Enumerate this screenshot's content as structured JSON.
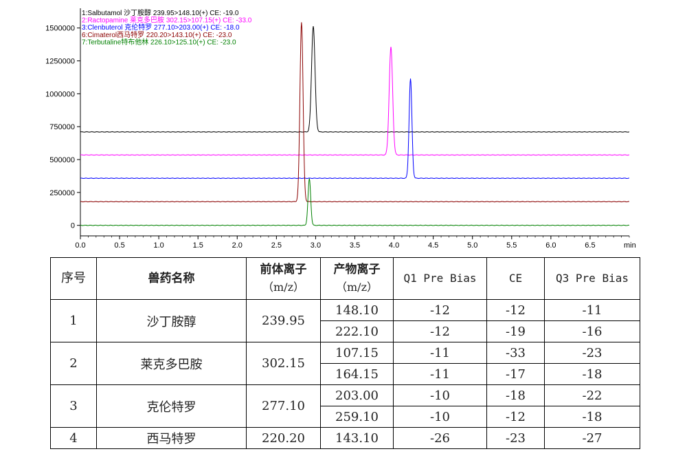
{
  "chart_data": {
    "type": "line",
    "xlabel": "min",
    "xlim": [
      0.0,
      7.0
    ],
    "ylim": [
      -80000,
      1650000
    ],
    "xticks": [
      "0.0",
      "0.5",
      "1.0",
      "1.5",
      "2.0",
      "2.5",
      "3.0",
      "3.5",
      "4.0",
      "4.5",
      "5.0",
      "5.5",
      "6.0",
      "6.5"
    ],
    "yticks": [
      {
        "value": 0,
        "label": "0"
      },
      {
        "value": 250000,
        "label": "250000"
      },
      {
        "value": 500000,
        "label": "500000"
      },
      {
        "value": 750000,
        "label": "750000"
      },
      {
        "value": 1000000,
        "label": "1000000"
      },
      {
        "value": 1250000,
        "label": "1250000"
      },
      {
        "value": 1500000,
        "label": "1500000"
      }
    ],
    "series": [
      {
        "name": "1:Salbutamol 沙丁胺醇 239.95>148.10(+) CE: -19.0",
        "color": "#000000",
        "baseline": 710000,
        "peak_time": 2.97,
        "peak_value": 1515000,
        "width": 0.022
      },
      {
        "name": "2:Ractopamine 莱克多巴胺 302.15>107.15(+) CE: -33.0",
        "color": "#ff00ff",
        "baseline": 535000,
        "peak_time": 3.96,
        "peak_value": 1355000,
        "width": 0.022
      },
      {
        "name": "3:Clenbuterol 克伦特罗 277.10>203.00(+) CE: -18.0",
        "color": "#0000ff",
        "baseline": 358000,
        "peak_time": 4.21,
        "peak_value": 1115000,
        "width": 0.018
      },
      {
        "name": "6:Cimaterol西马特罗 220.20>143.10(+) CE: -23.0",
        "color": "#8b0000",
        "baseline": 180000,
        "peak_time": 2.82,
        "peak_value": 1545000,
        "width": 0.02
      },
      {
        "name": "7:Terbutaline特布他林 226.10>125.10(+) CE: -23.0",
        "color": "#008000",
        "baseline": 0,
        "peak_time": 2.92,
        "peak_value": 355000,
        "width": 0.017
      }
    ]
  },
  "table": {
    "headers": {
      "index": "序号",
      "drug": "兽药名称",
      "precursor_line1": "前体离子",
      "precursor_line2": "（m/z）",
      "product_line1": "产物离子",
      "product_line2": "（m/z）",
      "q1": "Q1 Pre Bias",
      "ce": "CE",
      "q3": "Q3 Pre Bias"
    },
    "rows": [
      {
        "index": "1",
        "drug": "沙丁胺醇",
        "precursor": "239.95",
        "transitions": [
          {
            "product": "148.10",
            "q1": "-12",
            "ce": "-12",
            "q3": "-11"
          },
          {
            "product": "222.10",
            "q1": "-12",
            "ce": "-19",
            "q3": "-16"
          }
        ]
      },
      {
        "index": "2",
        "drug": "莱克多巴胺",
        "precursor": "302.15",
        "transitions": [
          {
            "product": "107.15",
            "q1": "-11",
            "ce": "-33",
            "q3": "-23"
          },
          {
            "product": "164.15",
            "q1": "-11",
            "ce": "-17",
            "q3": "-18"
          }
        ]
      },
      {
        "index": "3",
        "drug": "克伦特罗",
        "precursor": "277.10",
        "transitions": [
          {
            "product": "203.00",
            "q1": "-10",
            "ce": "-18",
            "q3": "-22"
          },
          {
            "product": "259.10",
            "q1": "-10",
            "ce": "-12",
            "q3": "-18"
          }
        ]
      },
      {
        "index": "4",
        "drug": "西马特罗",
        "precursor": "220.20",
        "transitions": [
          {
            "product": "143.10",
            "q1": "-26",
            "ce": "-23",
            "q3": "-27"
          }
        ]
      }
    ]
  }
}
